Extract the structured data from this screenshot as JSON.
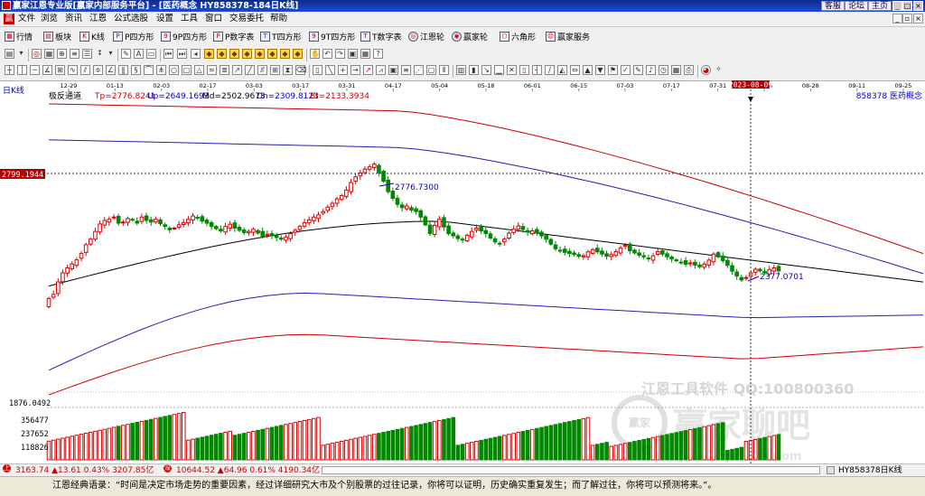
{
  "window": {
    "title": "赢家江恩专业版[赢家内部服务平台] - [医药概念  HY858378-184日K线]",
    "links": [
      "客服",
      "论坛",
      "主页"
    ]
  },
  "menu": [
    "文件",
    "浏览",
    "资讯",
    "江恩",
    "公式选股",
    "设置",
    "工具",
    "窗口",
    "交易委托",
    "帮助"
  ],
  "toolbar1": [
    {
      "label": "行情",
      "icon": "table-icon"
    },
    {
      "label": "板块",
      "icon": "blocks-icon"
    },
    {
      "label": "K线",
      "icon": "kline-icon"
    },
    {
      "label": "P四方形",
      "icon": "square-p-icon"
    },
    {
      "label": "9P四方形",
      "icon": "square-9p-icon"
    },
    {
      "label": "P数字表",
      "icon": "table-p-icon"
    },
    {
      "label": "T四方形",
      "icon": "square-t-icon"
    },
    {
      "label": "9T四方形",
      "icon": "square-9t-icon"
    },
    {
      "label": "T数字表",
      "icon": "table-t-icon"
    },
    {
      "label": "江恩轮",
      "icon": "gann-wheel-icon"
    },
    {
      "label": "赢家轮",
      "icon": "winner-wheel-icon"
    },
    {
      "label": "六角形",
      "icon": "hexagon-icon"
    },
    {
      "label": "赢家服务",
      "icon": "service-icon"
    }
  ],
  "chart": {
    "period_label": "日K线",
    "indicator_name": "极反通道",
    "indicators": [
      {
        "label": "Tp=2776.8241",
        "color": "#cc0000"
      },
      {
        "label": "Up=2649.1693",
        "color": "#0000cc"
      },
      {
        "label": "Md=2502.9673",
        "color": "#000000"
      },
      {
        "label": "Dn=2309.8123",
        "color": "#0000cc"
      },
      {
        "label": "Bt=2133.3934",
        "color": "#cc0000"
      }
    ],
    "symbol": "858378  医药概念",
    "date_ticks": [
      "12-29",
      "01-13",
      "02-03",
      "02-17",
      "03-03",
      "03-17",
      "03-31",
      "04-17",
      "05-04",
      "05-18",
      "06-01",
      "06-15",
      "07-03",
      "07-17",
      "07-31",
      "08-14",
      "08-28",
      "09-11",
      "09-25"
    ],
    "cursor_date": "2023-08-09",
    "crosshair_price": "2799.1944",
    "axis_low": "1876.0492",
    "high_label": "2776.7300",
    "low_label": "2377.0701",
    "volume_ticks": [
      "356477",
      "237652",
      "118826"
    ],
    "watermark_line1": "江恩工具软件  QQ:100800360",
    "watermark_line2": "赢家聊吧",
    "watermark_url": "jiaoba.yinsoft.com",
    "watermark_badge": "赢家"
  },
  "chart_data": {
    "type": "candlestick",
    "title": "医药概念 日K线",
    "price_range": [
      1876.0492,
      2930
    ],
    "close_series": [
      2225,
      2240,
      2285,
      2318,
      2336,
      2350,
      2365,
      2388,
      2420,
      2440,
      2468,
      2495,
      2508,
      2512,
      2520,
      2498,
      2502,
      2515,
      2510,
      2498,
      2520,
      2508,
      2502,
      2512,
      2496,
      2486,
      2474,
      2480,
      2492,
      2500,
      2512,
      2524,
      2516,
      2505,
      2498,
      2486,
      2478,
      2470,
      2486,
      2494,
      2480,
      2472,
      2464,
      2468,
      2476,
      2462,
      2450,
      2458,
      2452,
      2446,
      2440,
      2448,
      2460,
      2472,
      2486,
      2500,
      2510,
      2520,
      2528,
      2540,
      2556,
      2570,
      2586,
      2598,
      2618,
      2645,
      2666,
      2680,
      2694,
      2702,
      2712,
      2680,
      2650,
      2612,
      2588,
      2566,
      2554,
      2560,
      2545,
      2540,
      2520,
      2492,
      2460,
      2490,
      2512,
      2484,
      2460,
      2452,
      2442,
      2438,
      2454,
      2468,
      2480,
      2470,
      2460,
      2444,
      2430,
      2424,
      2440,
      2462,
      2476,
      2488,
      2475,
      2466,
      2470,
      2462,
      2452,
      2440,
      2422,
      2405,
      2398,
      2392,
      2388,
      2384,
      2378,
      2380,
      2394,
      2402,
      2394,
      2386,
      2378,
      2384,
      2395,
      2408,
      2418,
      2398,
      2390,
      2382,
      2376,
      2370,
      2380,
      2395,
      2386,
      2376,
      2368,
      2362,
      2356,
      2349,
      2354,
      2346,
      2340,
      2350,
      2364,
      2386,
      2376,
      2362,
      2345,
      2324,
      2306,
      2292,
      2301,
      2318,
      2331,
      2325,
      2318,
      2330,
      2336,
      2325
    ],
    "bands": [
      {
        "name": "Tp",
        "start": 2930,
        "end": 2388
      },
      {
        "name": "Up",
        "start": 2800,
        "end": 2315
      },
      {
        "name": "Md",
        "start": 2270,
        "end": 2285
      },
      {
        "name": "Dn",
        "start": 1965,
        "end": 2165
      },
      {
        "name": "Bt",
        "start": 1876,
        "end": 2050
      }
    ],
    "legend_values": {
      "Tp": 2776.8241,
      "Up": 2649.1693,
      "Md": 2502.9673,
      "Dn": 2309.8123,
      "Bt": 2133.3934
    },
    "annotations": {
      "high": 2776.73,
      "low": 2377.0701
    },
    "volume_ticks": [
      356477,
      237652,
      118826
    ],
    "candle_colors": {
      "up": "#dd0000",
      "down": "#008800"
    },
    "band_colors": {
      "red": "#cc0000",
      "blue": "#2020b0",
      "mid": "#000000"
    }
  },
  "status": {
    "sh_label": "上",
    "sh_values": "3163.74 ▲13.61 0.43% 3207.85亿",
    "sz_label": "深",
    "sz_values": "10644.52 ▲64.96 0.61% 4190.34亿",
    "right_text": "HY858378日K线"
  },
  "quote": "江恩经典语录：“时间是决定市场走势的重要因素，经过详细研究大市及个别股票的过往记录，你将可以证明，历史确实重复发生；而了解过往，你将可以预测将来。”。"
}
